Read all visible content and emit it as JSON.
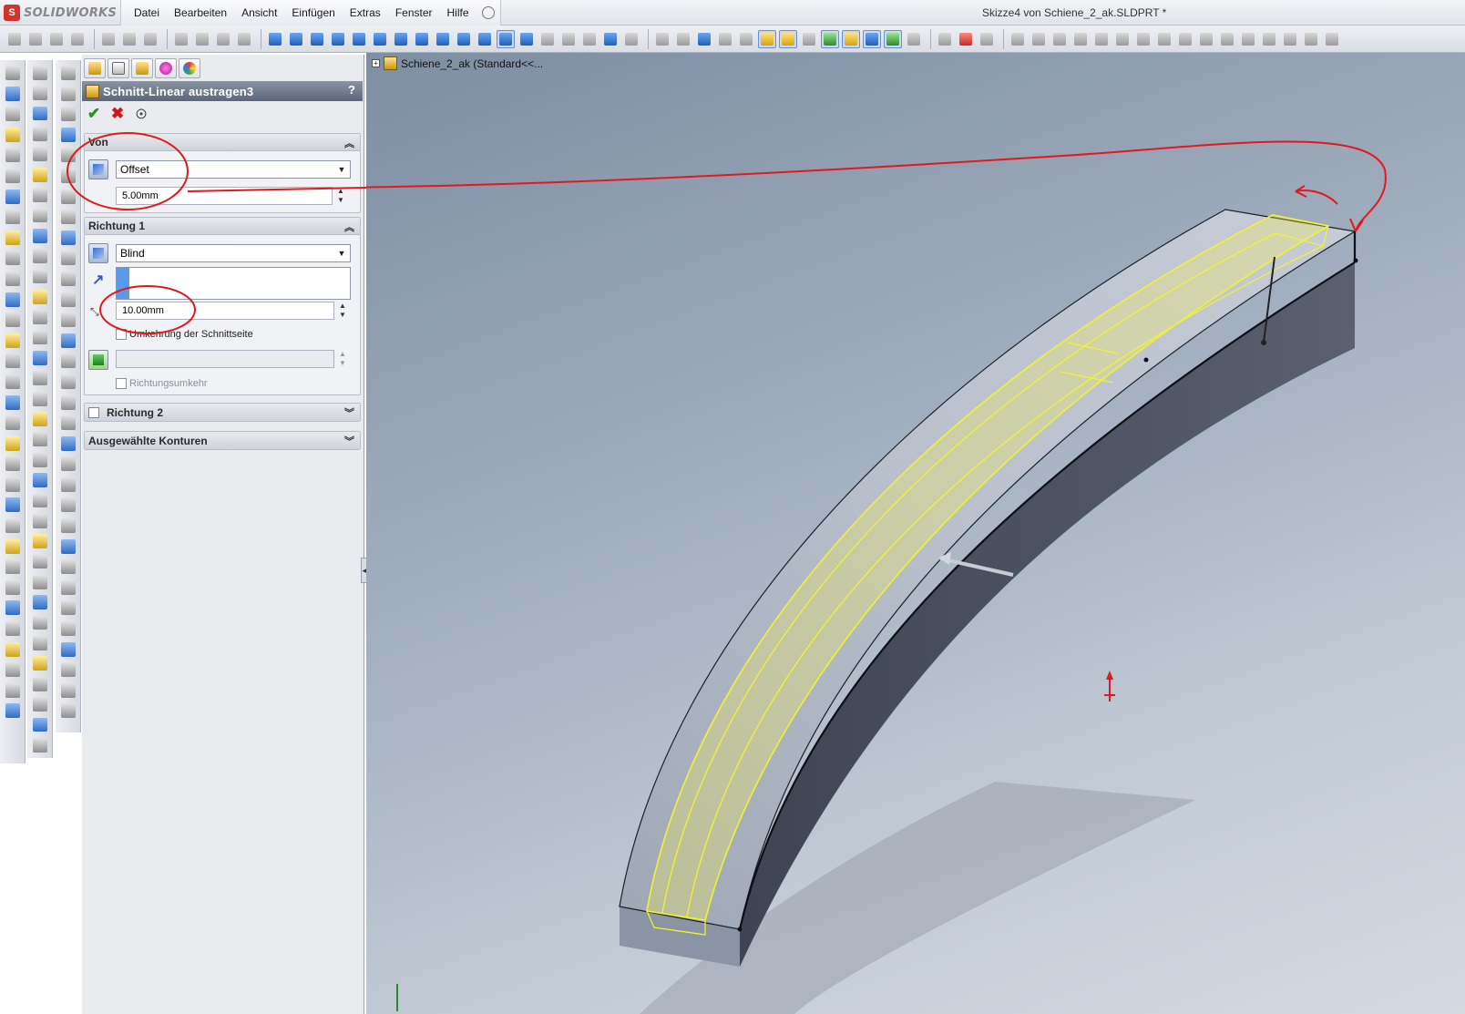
{
  "app": {
    "logo_text": "SOLIDWORKS",
    "document_title": "Skizze4 von Schiene_2_ak.SLDPRT *"
  },
  "menu": [
    "Datei",
    "Bearbeiten",
    "Ansicht",
    "Einfügen",
    "Extras",
    "Fenster",
    "Hilfe"
  ],
  "property_manager": {
    "title": "Schnitt-Linear austragen3",
    "help": "?",
    "from_group": {
      "header": "Von",
      "start_condition": "Offset",
      "offset_value": "5.00mm"
    },
    "direction1": {
      "header": "Richtung 1",
      "end_condition": "Blind",
      "depth_value": "10.00mm",
      "flip_side_label": "Umkehrung der Schnittseite",
      "reverse_label": "Richtungsumkehr"
    },
    "direction2": {
      "header": "Richtung 2"
    },
    "contours": {
      "header": "Ausgewählte Konturen"
    }
  },
  "feature_tree": {
    "label": "Schiene_2_ak  (Standard<<..."
  },
  "colors": {
    "accent_header": "#6a7386",
    "annotation_red": "#e0191e",
    "sketch_yellow": "#f2f230",
    "viewport_top": "#7e8ea3"
  }
}
